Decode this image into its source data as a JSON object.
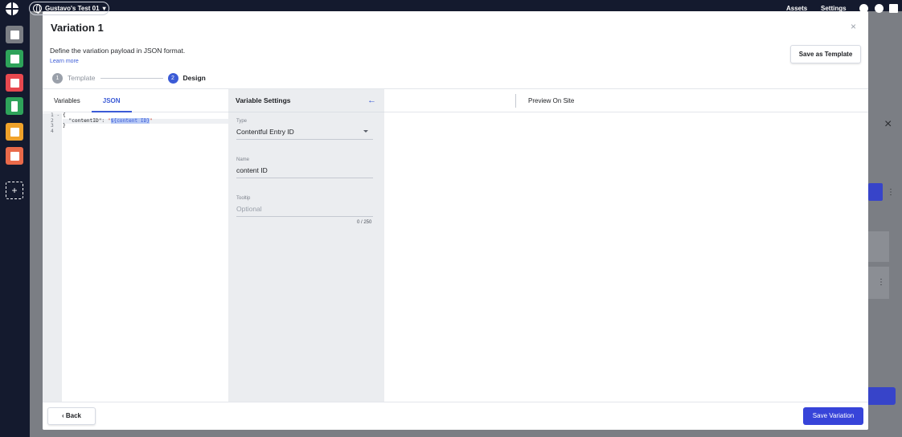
{
  "topbar": {
    "workspace_label": "Gustavo's Test 01",
    "links": {
      "assets": "Assets",
      "settings": "Settings"
    }
  },
  "rail": {
    "items": [
      {
        "name": "dashboard",
        "color": "#7b7e84"
      },
      {
        "name": "audiences",
        "color": "#2ea35a"
      },
      {
        "name": "web",
        "color": "#e8484f"
      },
      {
        "name": "mobile",
        "color": "#2ea35a"
      },
      {
        "name": "email",
        "color": "#f0a22a"
      },
      {
        "name": "product",
        "color": "#ea6a4a"
      }
    ],
    "add_label": "+"
  },
  "modal": {
    "title": "Variation 1",
    "close_label": "×",
    "description": "Define the variation payload in JSON format.",
    "learn_more": "Learn more",
    "save_template_label": "Save as Template",
    "steps": [
      {
        "number": "1",
        "label": "Template",
        "state": "done"
      },
      {
        "number": "2",
        "label": "Design",
        "state": "active"
      }
    ]
  },
  "left_panel": {
    "tabs": [
      {
        "label": "Variables",
        "active": false
      },
      {
        "label": "JSON",
        "active": true
      }
    ],
    "line_numbers": [
      "1 -",
      "2",
      "3",
      "4"
    ],
    "code": {
      "line1": "{",
      "line2_key": "  \"contentID\": ",
      "line2_open": "\"",
      "line2_value": "${content ID}",
      "line2_close": "\"",
      "line3": "}",
      "line4": ""
    }
  },
  "variable_settings": {
    "title": "Variable Settings",
    "back_icon": "arrow-left-icon",
    "type_label": "Type",
    "type_value": "Contentful Entry ID",
    "name_label": "Name",
    "name_value": "content ID",
    "tooltip_label": "Tooltip",
    "tooltip_placeholder": "Optional",
    "counter": "0 / 250"
  },
  "preview": {
    "label": "Preview On Site"
  },
  "footer": {
    "back_label": "‹ Back",
    "save_label": "Save Variation"
  },
  "colors": {
    "accent": "#3b5bd6",
    "primary_button": "#3744d9",
    "topbar": "#141a2e"
  }
}
